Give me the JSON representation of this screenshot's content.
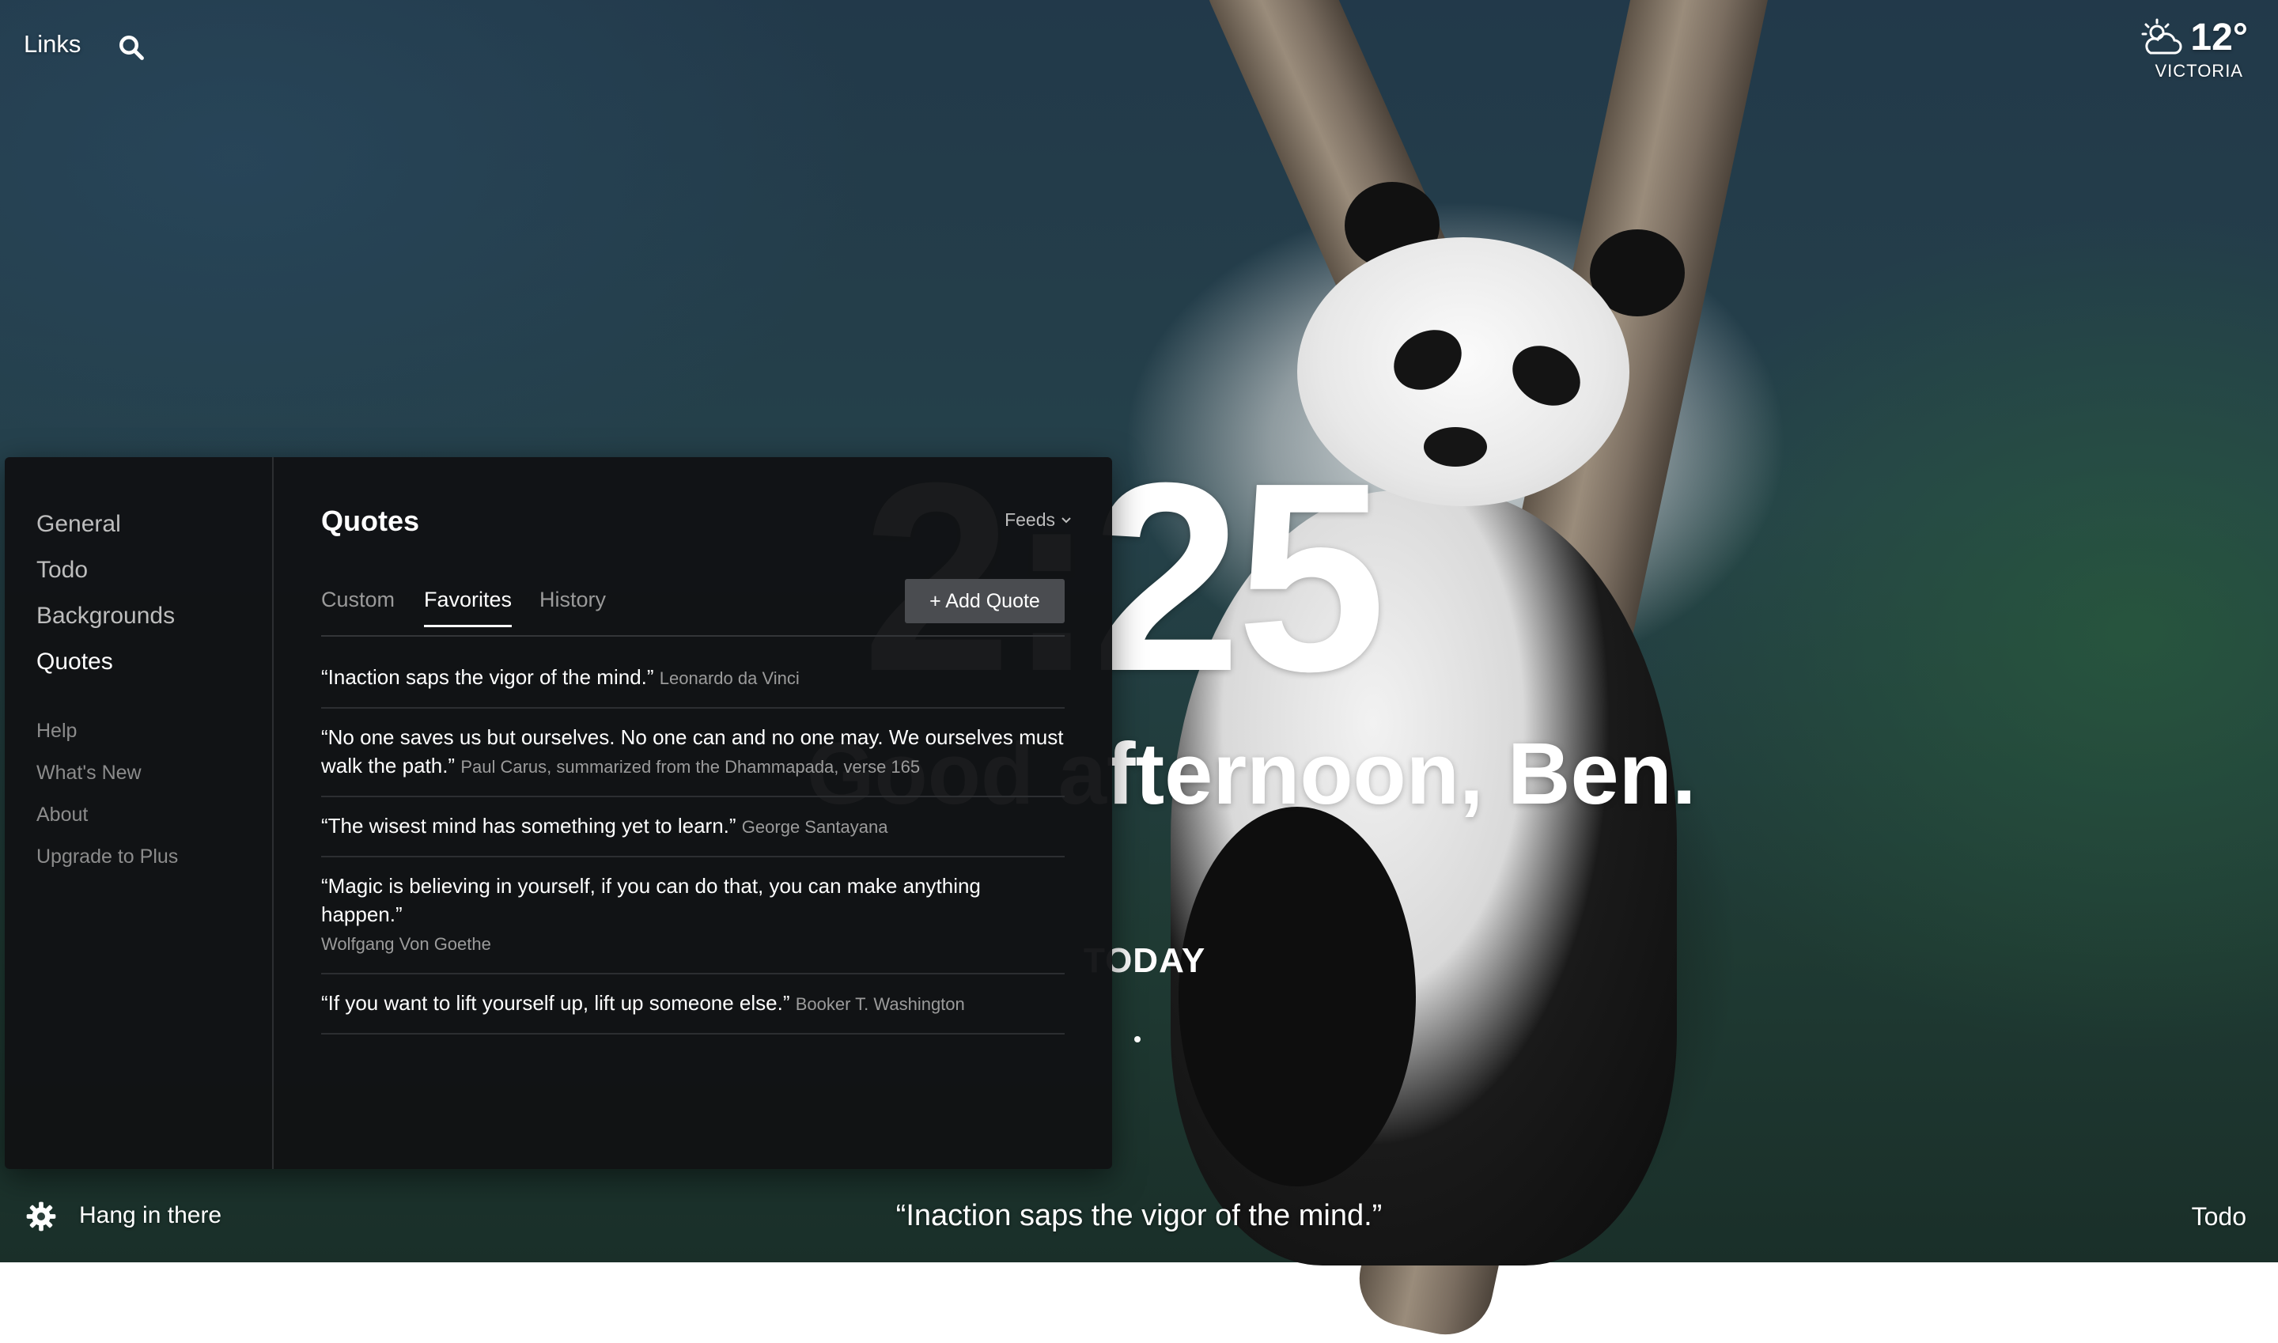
{
  "topbar": {
    "links_label": "Links",
    "search_icon": "search-icon"
  },
  "weather": {
    "icon": "partly-cloudy-icon",
    "temperature": "12°",
    "location": "VICTORIA"
  },
  "dashboard": {
    "clock": "2:25",
    "greeting": "Good afternoon, Ben.",
    "focus_label": "TODAY"
  },
  "settings": {
    "nav_main": [
      "General",
      "Todo",
      "Backgrounds",
      "Quotes"
    ],
    "nav_active": "Quotes",
    "nav_secondary": [
      "Help",
      "What's New",
      "About",
      "Upgrade to Plus"
    ],
    "title": "Quotes",
    "feeds_label": "Feeds",
    "tabs": [
      "Custom",
      "Favorites",
      "History"
    ],
    "active_tab": "Favorites",
    "add_quote_label": "+ Add Quote",
    "quotes": [
      {
        "text": "“Inaction saps the vigor of the mind.”",
        "author": "Leonardo da Vinci"
      },
      {
        "text": "“No one saves us but ourselves. No one can and no one may. We ourselves must walk the path.”",
        "author": "Paul Carus, summarized from the Dhammapada, verse 165"
      },
      {
        "text": "“The wisest mind has something yet to learn.”",
        "author": "George Santayana"
      },
      {
        "text": "“Magic is believing in yourself, if you can do that, you can make anything happen.”",
        "author": "Wolfgang Von Goethe"
      },
      {
        "text": "“If you want to lift yourself up, lift up someone else.”",
        "author": "Booker T. Washington"
      }
    ]
  },
  "bottombar": {
    "settings_icon": "gear-icon",
    "mantra": "Hang in there",
    "quote": "“Inaction saps the vigor of the mind.”",
    "todo_label": "Todo"
  }
}
